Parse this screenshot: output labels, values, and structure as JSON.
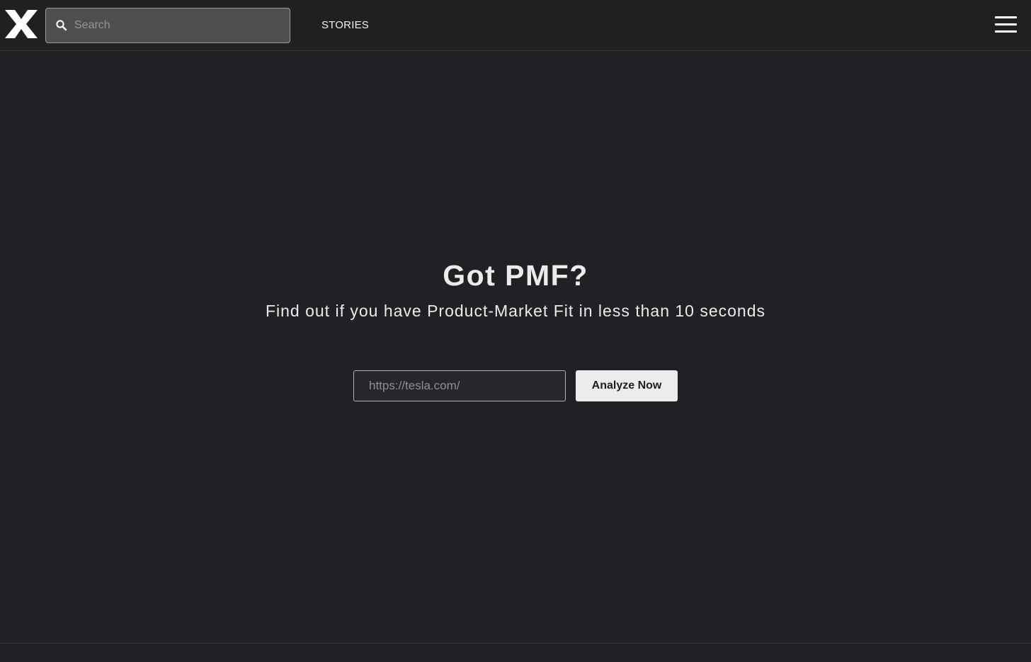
{
  "header": {
    "logo_icon": "x-logo-icon",
    "search": {
      "icon": "search-icon",
      "placeholder": "Search",
      "value": ""
    },
    "nav": {
      "stories_label": "STORIES"
    },
    "menu_icon": "hamburger-menu-icon"
  },
  "hero": {
    "title": "Got PMF?",
    "subtitle": "Find out if you have Product-Market Fit in less than 10 seconds"
  },
  "analyze_form": {
    "url_placeholder": "https://tesla.com/",
    "url_value": "",
    "button_label": "Analyze Now"
  },
  "colors": {
    "page_background": "#202125",
    "header_background": "#202020",
    "search_background": "#4e4e4e",
    "button_background": "#ececec",
    "text": "#ececec"
  }
}
